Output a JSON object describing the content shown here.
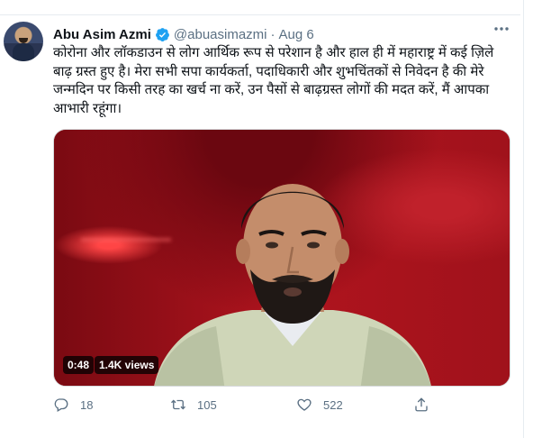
{
  "tweet": {
    "author": {
      "name": "Abu Asim Azmi",
      "handle": "@abuasimazmi",
      "verified": true,
      "avatar_icon": "profile-photo"
    },
    "separator": "·",
    "date": "Aug 6",
    "text": "कोरोना और लॉकडाउन से लोग आर्थिक रूप से परेशान है और हाल ही में महाराष्ट्र में कई ज़िले बाढ़ ग्रस्त हुए है। मेरा सभी सपा कार्यकर्ता, पदाधिकारी और शुभचिंतकों से निवेदन है की मेरे जन्मदिन पर किसी तरह का खर्च ना करें, उन पैसों से बाढ़ग्रस्त लोगों की मदत करें, मैं आपका आभारी रहूंगा।",
    "media": {
      "type": "video",
      "duration": "0:48",
      "views": "1.4K views"
    },
    "actions": {
      "replies": "18",
      "retweets": "105",
      "likes": "522"
    }
  },
  "colors": {
    "text_primary": "#0f1419",
    "text_secondary": "#5b7083",
    "verified_blue": "#1da1f2",
    "border": "#e6ecf0"
  },
  "icons": {
    "reply": "reply-icon",
    "retweet": "retweet-icon",
    "like": "heart-icon",
    "share": "share-icon",
    "more": "more-options-icon",
    "verified": "verified-badge-icon"
  }
}
